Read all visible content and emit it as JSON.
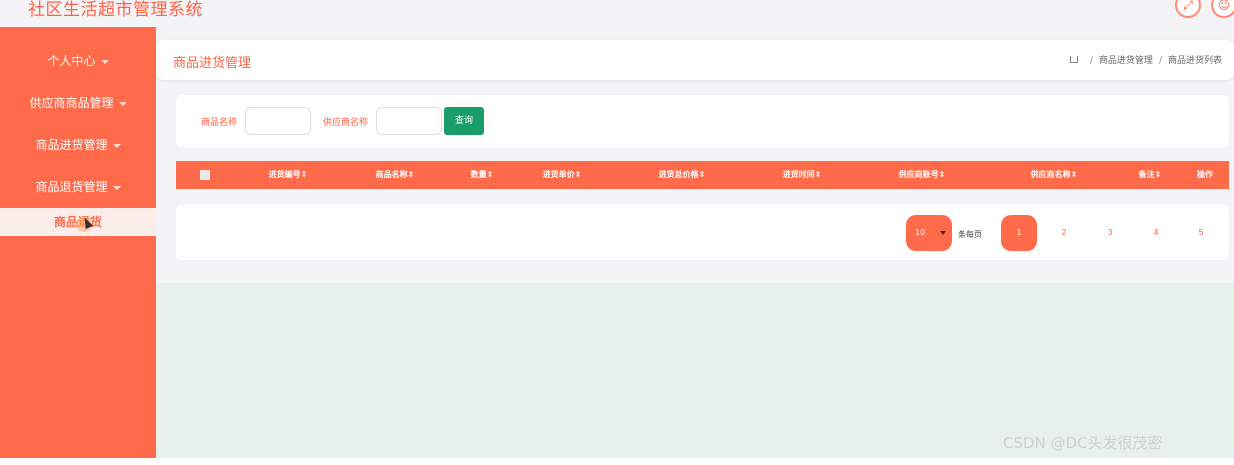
{
  "app": {
    "title": "社区生活超市管理系统"
  },
  "top_icons": {
    "fullscreen": "fullscreen-icon",
    "user": "user-icon"
  },
  "sidebar": {
    "items": [
      {
        "label": "个人中心"
      },
      {
        "label": "供应商商品管理"
      },
      {
        "label": "商品进货管理"
      },
      {
        "label": "商品退货管理"
      }
    ],
    "submenu_active": "商品退货"
  },
  "header": {
    "title": "商品进货管理",
    "breadcrumb": [
      "商品进货管理",
      "商品进货列表"
    ],
    "separator": "/"
  },
  "search": {
    "fields": [
      {
        "label": "商品名称",
        "value": ""
      },
      {
        "label": "供应商名称",
        "value": ""
      }
    ],
    "button": "查询"
  },
  "table": {
    "columns": [
      "进货编号",
      "商品名称",
      "数量",
      "进货单价",
      "进货总价格",
      "进货时间",
      "供应商账号",
      "供应商名称",
      "备注",
      "操作"
    ],
    "sort_mark": "⇕"
  },
  "pager": {
    "page_size": "10",
    "per_page_label": "条每页",
    "pages": [
      "1",
      "2",
      "3",
      "4",
      "5"
    ],
    "current_page": "1"
  },
  "watermark": "CSDN @DC头发很茂密",
  "colors": {
    "accent": "#ff6b4a",
    "query_button": "#1a9d6b",
    "main_bg": "#e8f0eb"
  }
}
